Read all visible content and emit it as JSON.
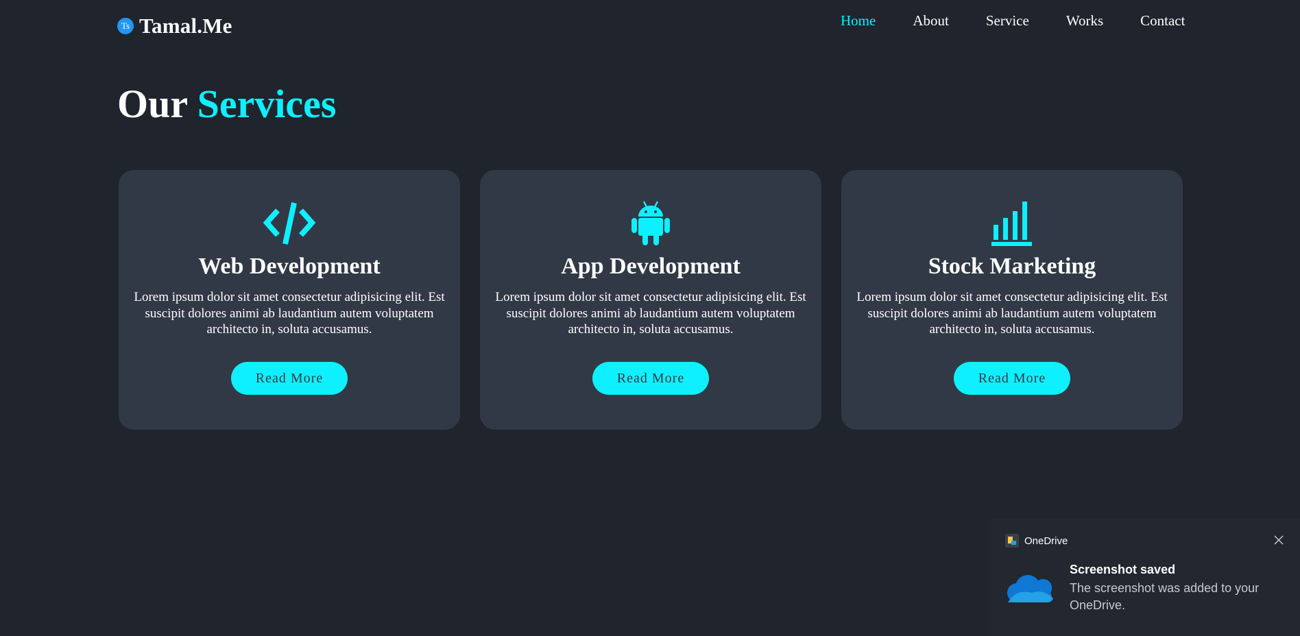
{
  "brand": {
    "badge": "Ts",
    "name": "Tamal.Me"
  },
  "nav": {
    "items": [
      {
        "label": "Home",
        "active": true
      },
      {
        "label": "About",
        "active": false
      },
      {
        "label": "Service",
        "active": false
      },
      {
        "label": "Works",
        "active": false
      },
      {
        "label": "Contact",
        "active": false
      }
    ]
  },
  "section": {
    "title_prefix": "Our",
    "title_accent": "Services"
  },
  "cards": [
    {
      "icon": "code-icon",
      "title": "Web Development",
      "text": "Lorem ipsum dolor sit amet consectetur adipisicing elit. Est suscipit dolores animi ab laudantium autem voluptatem architecto in, soluta accusamus.",
      "button": "Read More"
    },
    {
      "icon": "android-icon",
      "title": "App Development",
      "text": "Lorem ipsum dolor sit amet consectetur adipisicing elit. Est suscipit dolores animi ab laudantium autem voluptatem architecto in, soluta accusamus.",
      "button": "Read More"
    },
    {
      "icon": "bar-chart-icon",
      "title": "Stock Marketing",
      "text": "Lorem ipsum dolor sit amet consectetur adipisicing elit. Est suscipit dolores animi ab laudantium autem voluptatem architecto in, soluta accusamus.",
      "button": "Read More"
    }
  ],
  "toast": {
    "app_name": "OneDrive",
    "title": "Screenshot saved",
    "body": "The screenshot was added to your OneDrive."
  },
  "colors": {
    "background": "#1f242d",
    "card": "#323946",
    "accent": "#0ef0ff",
    "text": "#ffffff"
  }
}
